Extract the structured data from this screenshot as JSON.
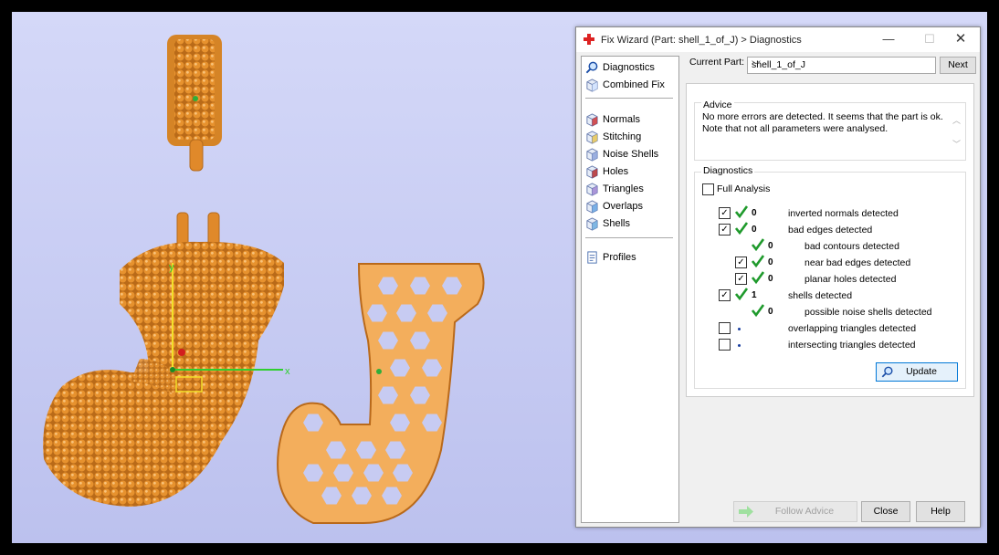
{
  "window": {
    "title": "Fix Wizard (Part: shell_1_of_J) > Diagnostics",
    "minimize_label": "—",
    "maximize_label": "☐",
    "close_label": "✕"
  },
  "sidebar": {
    "items": [
      {
        "label": "Diagnostics",
        "icon": "magnifier-icon"
      },
      {
        "label": "Combined Fix",
        "icon": "cube-icon"
      },
      {
        "label": "Normals",
        "icon": "normals-cube-icon"
      },
      {
        "label": "Stitching",
        "icon": "stitching-cube-icon"
      },
      {
        "label": "Noise Shells",
        "icon": "noise-shells-cube-icon"
      },
      {
        "label": "Holes",
        "icon": "holes-cube-icon"
      },
      {
        "label": "Triangles",
        "icon": "triangles-cube-icon"
      },
      {
        "label": "Overlaps",
        "icon": "overlaps-cube-icon"
      },
      {
        "label": "Shells",
        "icon": "shells-cube-icon"
      },
      {
        "label": "Profiles",
        "icon": "document-icon"
      }
    ]
  },
  "current_part": {
    "label": "Current Part:",
    "value": "shell_1_of_J",
    "next_label": "Next"
  },
  "advice": {
    "title": "Advice",
    "line1": "No more errors are detected. It seems that the part is ok.",
    "line2": "Note that not all parameters were analysed."
  },
  "diagnostics": {
    "title": "Diagnostics",
    "full_analysis": {
      "label": "Full Analysis",
      "checked": false
    },
    "rows": [
      {
        "text": "inverted normals detected",
        "count": "0",
        "checkbox": true,
        "checked": true,
        "status": "ok"
      },
      {
        "text": "bad edges detected",
        "count": "0",
        "checkbox": true,
        "checked": true,
        "status": "ok"
      },
      {
        "text": "bad contours detected",
        "count": "0",
        "checkbox": false,
        "checked": false,
        "status": "ok"
      },
      {
        "text": "near bad edges detected",
        "count": "0",
        "checkbox": true,
        "checked": true,
        "status": "ok"
      },
      {
        "text": "planar holes detected",
        "count": "0",
        "checkbox": true,
        "checked": true,
        "status": "ok"
      },
      {
        "text": "shells detected",
        "count": "1",
        "checkbox": true,
        "checked": true,
        "status": "ok"
      },
      {
        "text": "possible noise shells detected",
        "count": "0",
        "checkbox": false,
        "checked": false,
        "status": "ok"
      },
      {
        "text": "overlapping triangles detected",
        "count": "",
        "checkbox": true,
        "checked": false,
        "status": "pending"
      },
      {
        "text": "intersecting triangles detected",
        "count": "",
        "checkbox": true,
        "checked": false,
        "status": "pending"
      }
    ],
    "update_label": "Update"
  },
  "footer": {
    "follow_advice_label": "Follow Advice",
    "close_label": "Close",
    "help_label": "Help"
  },
  "viewport": {
    "axis_x_label": "x",
    "axis_y_label": "y",
    "model_color": "#e8922e",
    "background": "#c8ccf4"
  }
}
